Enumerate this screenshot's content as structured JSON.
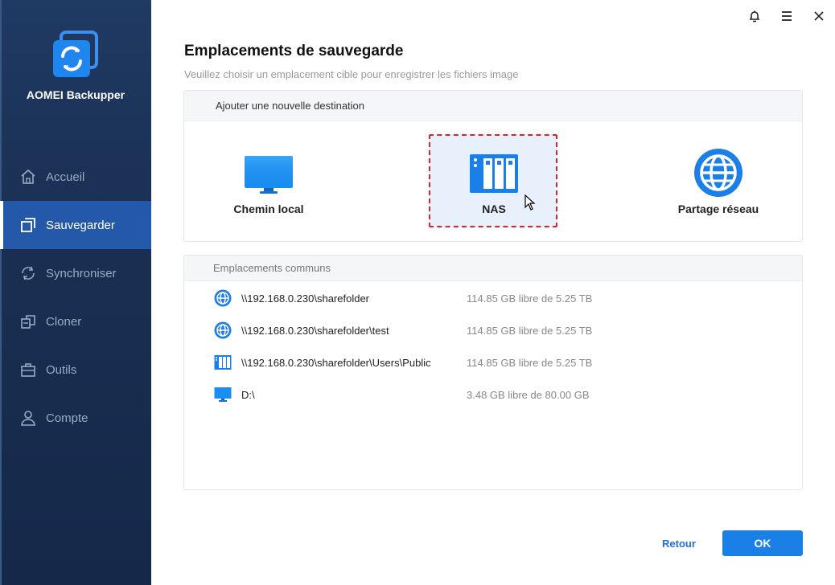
{
  "app": {
    "name": "AOMEI Backupper"
  },
  "sidebar": {
    "items": [
      {
        "label": "Accueil",
        "icon": "home-icon"
      },
      {
        "label": "Sauvegarder",
        "icon": "backup-icon",
        "active": true
      },
      {
        "label": "Synchroniser",
        "icon": "sync-icon"
      },
      {
        "label": "Cloner",
        "icon": "clone-icon"
      },
      {
        "label": "Outils",
        "icon": "tools-icon"
      },
      {
        "label": "Compte",
        "icon": "account-icon"
      }
    ]
  },
  "titlebar": {
    "icons": [
      "bell-icon",
      "menu-icon",
      "close-icon"
    ]
  },
  "main": {
    "title": "Emplacements de sauvegarde",
    "subtitle": "Veuillez choisir un emplacement cible pour enregistrer les fichiers image",
    "add_destination": {
      "header": "Ajouter une nouvelle destination",
      "options": [
        {
          "label": "Chemin local",
          "icon": "monitor-icon"
        },
        {
          "label": "NAS",
          "icon": "nas-icon",
          "highlighted": true
        },
        {
          "label": "Partage réseau",
          "icon": "globe-icon"
        }
      ]
    },
    "common": {
      "header": "Emplacements communs",
      "rows": [
        {
          "path": "\\\\192.168.0.230\\sharefolder",
          "size": "114.85 GB libre de 5.25 TB",
          "icon": "globe-icon"
        },
        {
          "path": "\\\\192.168.0.230\\sharefolder\\test",
          "size": "114.85 GB libre de 5.25 TB",
          "icon": "globe-icon"
        },
        {
          "path": "\\\\192.168.0.230\\sharefolder\\Users\\Public",
          "size": "114.85 GB libre de 5.25 TB",
          "icon": "nas-icon"
        },
        {
          "path": "D:\\",
          "size": "3.48 GB libre de 80.00 GB",
          "icon": "monitor-icon"
        }
      ]
    }
  },
  "footer": {
    "back_label": "Retour",
    "ok_label": "OK"
  },
  "colors": {
    "sidebar": "#1a2f52",
    "active": "#2458a8",
    "accent": "#1a7fe6",
    "highlight_border": "#d9262e"
  }
}
